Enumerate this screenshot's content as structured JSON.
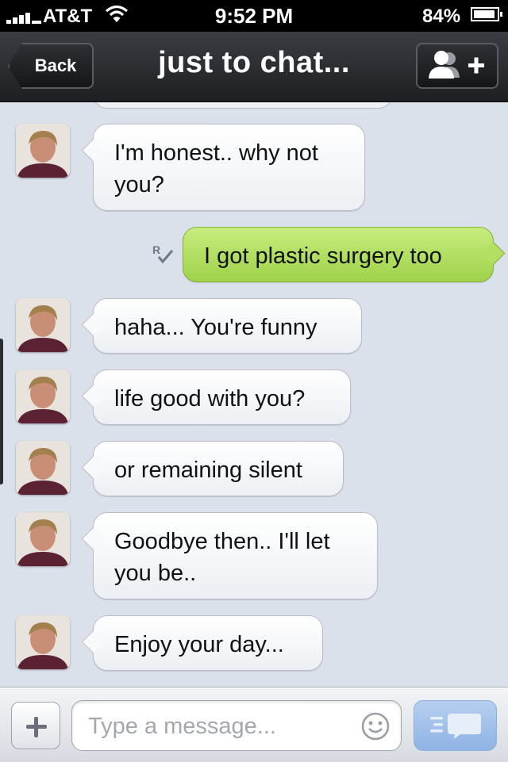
{
  "status_bar": {
    "carrier": "AT&T",
    "time": "9:52 PM",
    "battery": "84%",
    "battery_level": 0.84
  },
  "nav": {
    "back_label": "Back",
    "title": "just to chat..."
  },
  "messages": [
    {
      "direction": "in",
      "text_lines": [
        "I'm honest.. why not",
        "you?"
      ]
    },
    {
      "direction": "out",
      "text_lines": [
        "I got plastic surgery too"
      ]
    },
    {
      "direction": "in",
      "text_lines": [
        "haha... You're funny"
      ]
    },
    {
      "direction": "in",
      "text_lines": [
        "life good with you?"
      ]
    },
    {
      "direction": "in",
      "text_lines": [
        "or remaining silent"
      ]
    },
    {
      "direction": "in",
      "text_lines": [
        "Goodbye then.. I'll let",
        "you be.."
      ]
    },
    {
      "direction": "in",
      "text_lines": [
        "Enjoy your day..."
      ]
    }
  ],
  "composer": {
    "placeholder": "Type a message..."
  },
  "colors": {
    "background": "#dbe1ea",
    "incoming_bubble": "#ffffff",
    "outgoing_bubble": "#b3df63",
    "send_button": "#a3c1ea"
  },
  "icons": [
    "signal-icon",
    "wifi-icon",
    "battery-icon",
    "add-contact-icon",
    "read-receipt-icon",
    "plus-icon",
    "smiley-icon",
    "send-icon",
    "avatar"
  ]
}
